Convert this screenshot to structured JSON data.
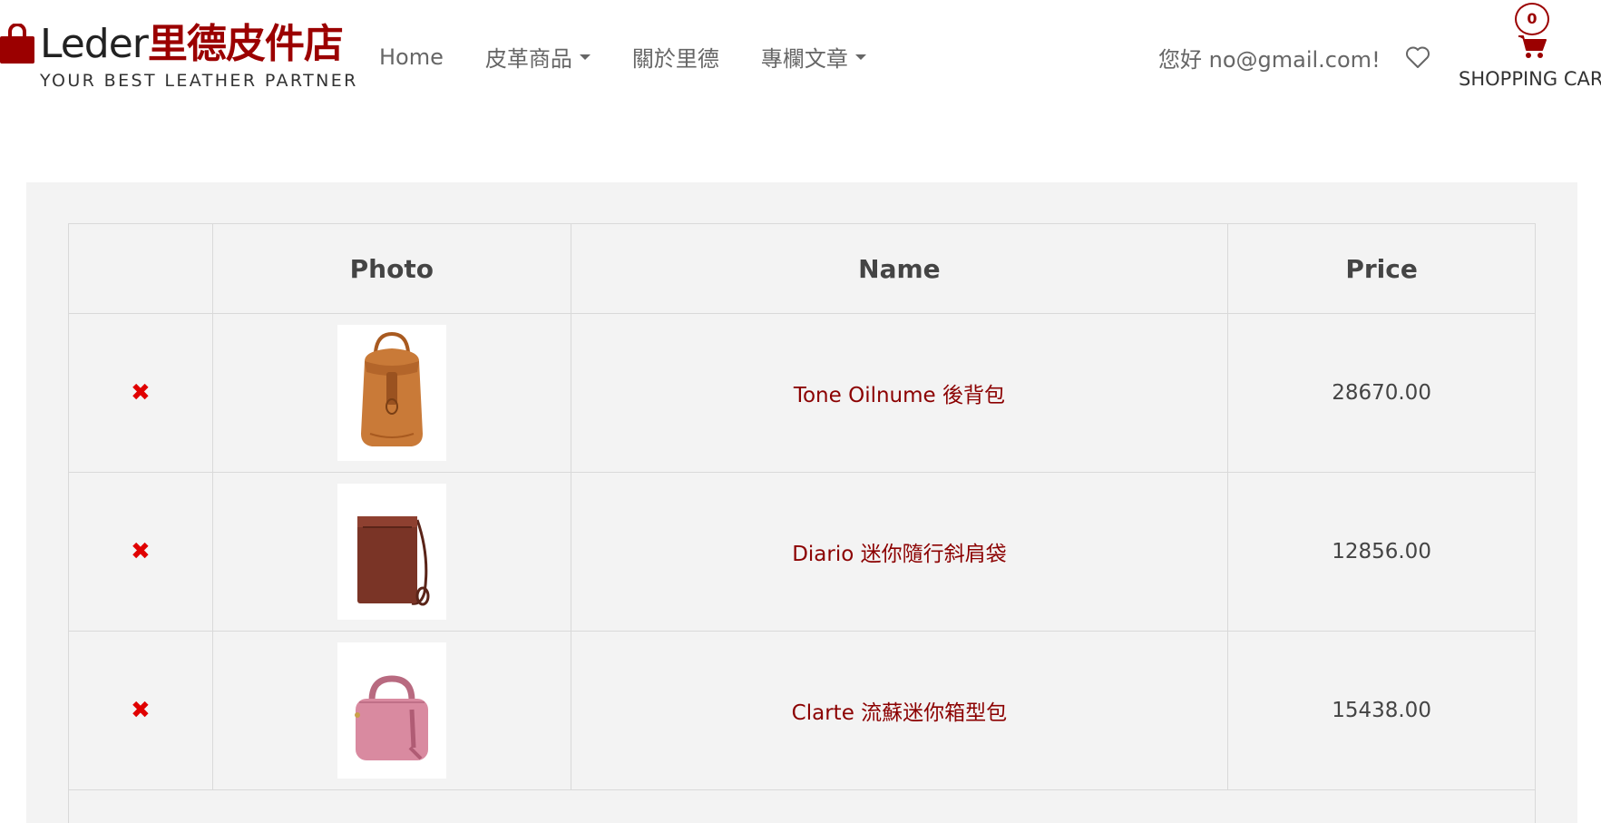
{
  "brand": {
    "name_en": "Leder",
    "name_zh": "里德皮件店",
    "slogan": "YOUR BEST LEATHER PARTNER"
  },
  "nav": {
    "home": "Home",
    "products": "皮革商品",
    "about": "關於里德",
    "articles": "專欄文章"
  },
  "user": {
    "greeting": "您好 no@gmail.com!"
  },
  "cart": {
    "count": "0",
    "label": "SHOPPING CART"
  },
  "table": {
    "headers": {
      "remove": "",
      "photo": "Photo",
      "name": "Name",
      "price": "Price"
    },
    "rows": [
      {
        "remove_icon": "✖",
        "photo": "tan-leather-backpack",
        "name": "Tone Oilnume 後背包",
        "price": "28670.00"
      },
      {
        "remove_icon": "✖",
        "photo": "brown-crossbody-bag",
        "name": "Diario 迷你隨行斜肩袋",
        "price": "12856.00"
      },
      {
        "remove_icon": "✖",
        "photo": "pink-mini-box-bag",
        "name": "Clarte 流蘇迷你箱型包",
        "price": "15438.00"
      }
    ]
  },
  "colors": {
    "brand_red": "#9b0000",
    "product_link": "#8b0000",
    "remove_red": "#e00000",
    "panel_bg": "#f3f3f3"
  }
}
